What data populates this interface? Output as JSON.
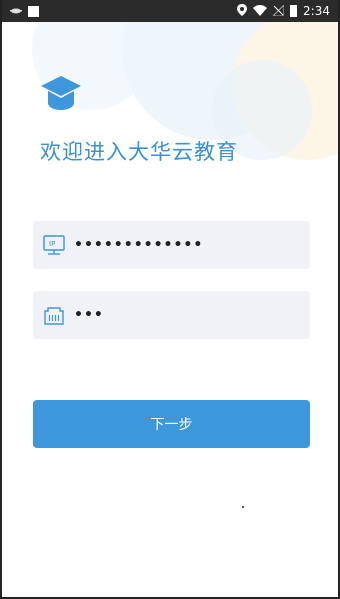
{
  "status_bar": {
    "time": "2:34",
    "left_icons": [
      "notification-icon",
      "square-icon"
    ],
    "right_icons": [
      "location-icon",
      "wifi-icon",
      "signal-off-icon",
      "battery-icon"
    ]
  },
  "header": {
    "logo_icon": "graduation-cap-icon",
    "welcome_text": "欢迎进入大华云教育"
  },
  "form": {
    "ip_field": {
      "icon": "ip-monitor-icon",
      "value": "•••••••••••••"
    },
    "port_field": {
      "icon": "network-port-icon",
      "value": "•••"
    },
    "next_button_label": "下一步"
  },
  "colors": {
    "accent": "#3c97dc",
    "title": "#3a92d3",
    "field_bg": "#f0f2f7"
  }
}
